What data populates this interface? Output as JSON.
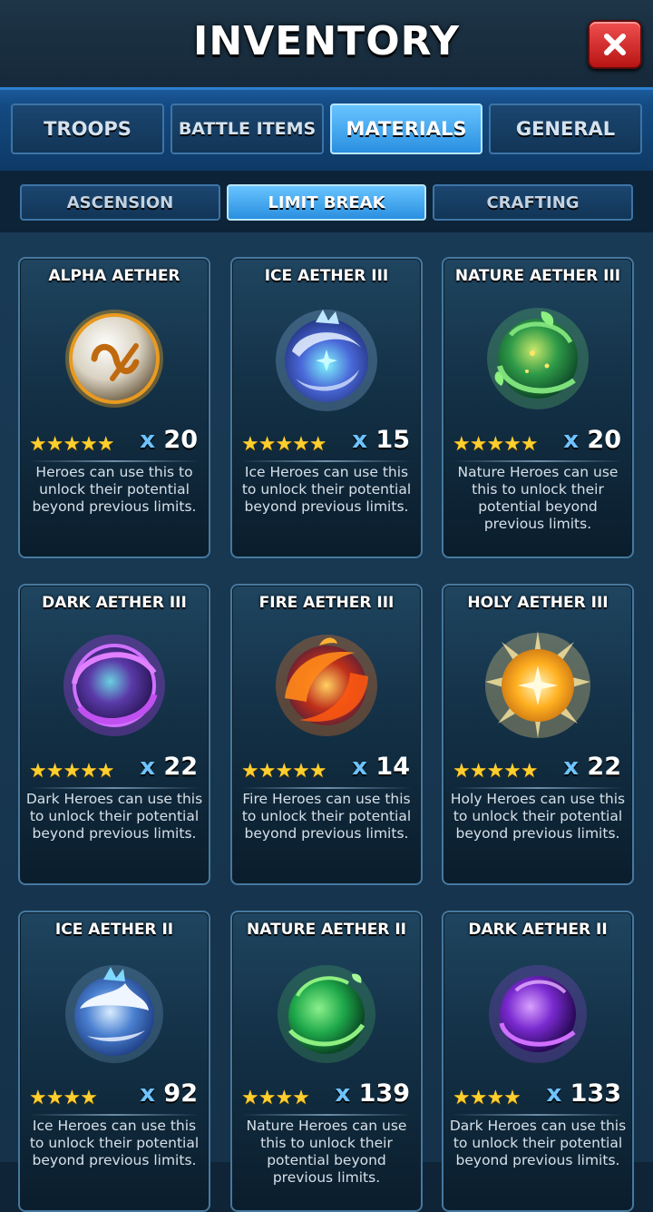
{
  "header": {
    "title": "INVENTORY"
  },
  "tabs": [
    {
      "label": "TROOPS",
      "active": false
    },
    {
      "label": "BATTLE ITEMS",
      "active": false
    },
    {
      "label": "MATERIALS",
      "active": true
    },
    {
      "label": "GENERAL",
      "active": false
    }
  ],
  "subtabs": [
    {
      "label": "ASCENSION",
      "active": false
    },
    {
      "label": "LIMIT BREAK",
      "active": true
    },
    {
      "label": "CRAFTING",
      "active": false
    }
  ],
  "items": [
    {
      "name": "ALPHA AETHER",
      "stars": "★★★★★",
      "star_count": 5,
      "qty_prefix": "x",
      "qty": "20",
      "desc": "Heroes can use this to unlock their potential beyond previous limits.",
      "icon": "alpha-orb-icon",
      "color": "#e6dcc4"
    },
    {
      "name": "ICE AETHER III",
      "stars": "★★★★★",
      "star_count": 5,
      "qty_prefix": "x",
      "qty": "15",
      "desc": "Ice Heroes can use this to unlock their potential beyond previous limits.",
      "icon": "ice-orb-icon",
      "color": "#8fb6ff"
    },
    {
      "name": "NATURE AETHER III",
      "stars": "★★★★★",
      "star_count": 5,
      "qty_prefix": "x",
      "qty": "20",
      "desc": "Nature Heroes can use this to unlock their potential beyond previous limits.",
      "icon": "nature-orb-icon",
      "color": "#4cc04a"
    },
    {
      "name": "DARK AETHER III",
      "stars": "★★★★★",
      "star_count": 5,
      "qty_prefix": "x",
      "qty": "22",
      "desc": "Dark Heroes can use this to unlock their potential beyond previous limits.",
      "icon": "dark-orb-icon",
      "color": "#b04ee6"
    },
    {
      "name": "FIRE AETHER III",
      "stars": "★★★★★",
      "star_count": 5,
      "qty_prefix": "x",
      "qty": "14",
      "desc": "Fire Heroes can use this to unlock their potential beyond previous limits.",
      "icon": "fire-orb-icon",
      "color": "#ff6a1a"
    },
    {
      "name": "HOLY AETHER III",
      "stars": "★★★★★",
      "star_count": 5,
      "qty_prefix": "x",
      "qty": "22",
      "desc": "Holy Heroes can use this to unlock their potential beyond previous limits.",
      "icon": "holy-orb-icon",
      "color": "#ffbe2e"
    },
    {
      "name": "ICE AETHER II",
      "stars": "★★★★",
      "star_count": 4,
      "qty_prefix": "x",
      "qty": "92",
      "desc": "Ice Heroes can use this to unlock their potential beyond previous limits.",
      "icon": "ice-orb-icon",
      "color": "#7aa6e8"
    },
    {
      "name": "NATURE AETHER II",
      "stars": "★★★★",
      "star_count": 4,
      "qty_prefix": "x",
      "qty": "139",
      "desc": "Nature Heroes can use this to unlock their potential beyond previous limits.",
      "icon": "nature-orb-icon",
      "color": "#2fae46"
    },
    {
      "name": "DARK AETHER II",
      "stars": "★★★★",
      "star_count": 4,
      "qty_prefix": "x",
      "qty": "133",
      "desc": "Dark Heroes can use this to unlock their potential beyond previous limits.",
      "icon": "dark-orb-icon",
      "color": "#9a48e0"
    }
  ]
}
